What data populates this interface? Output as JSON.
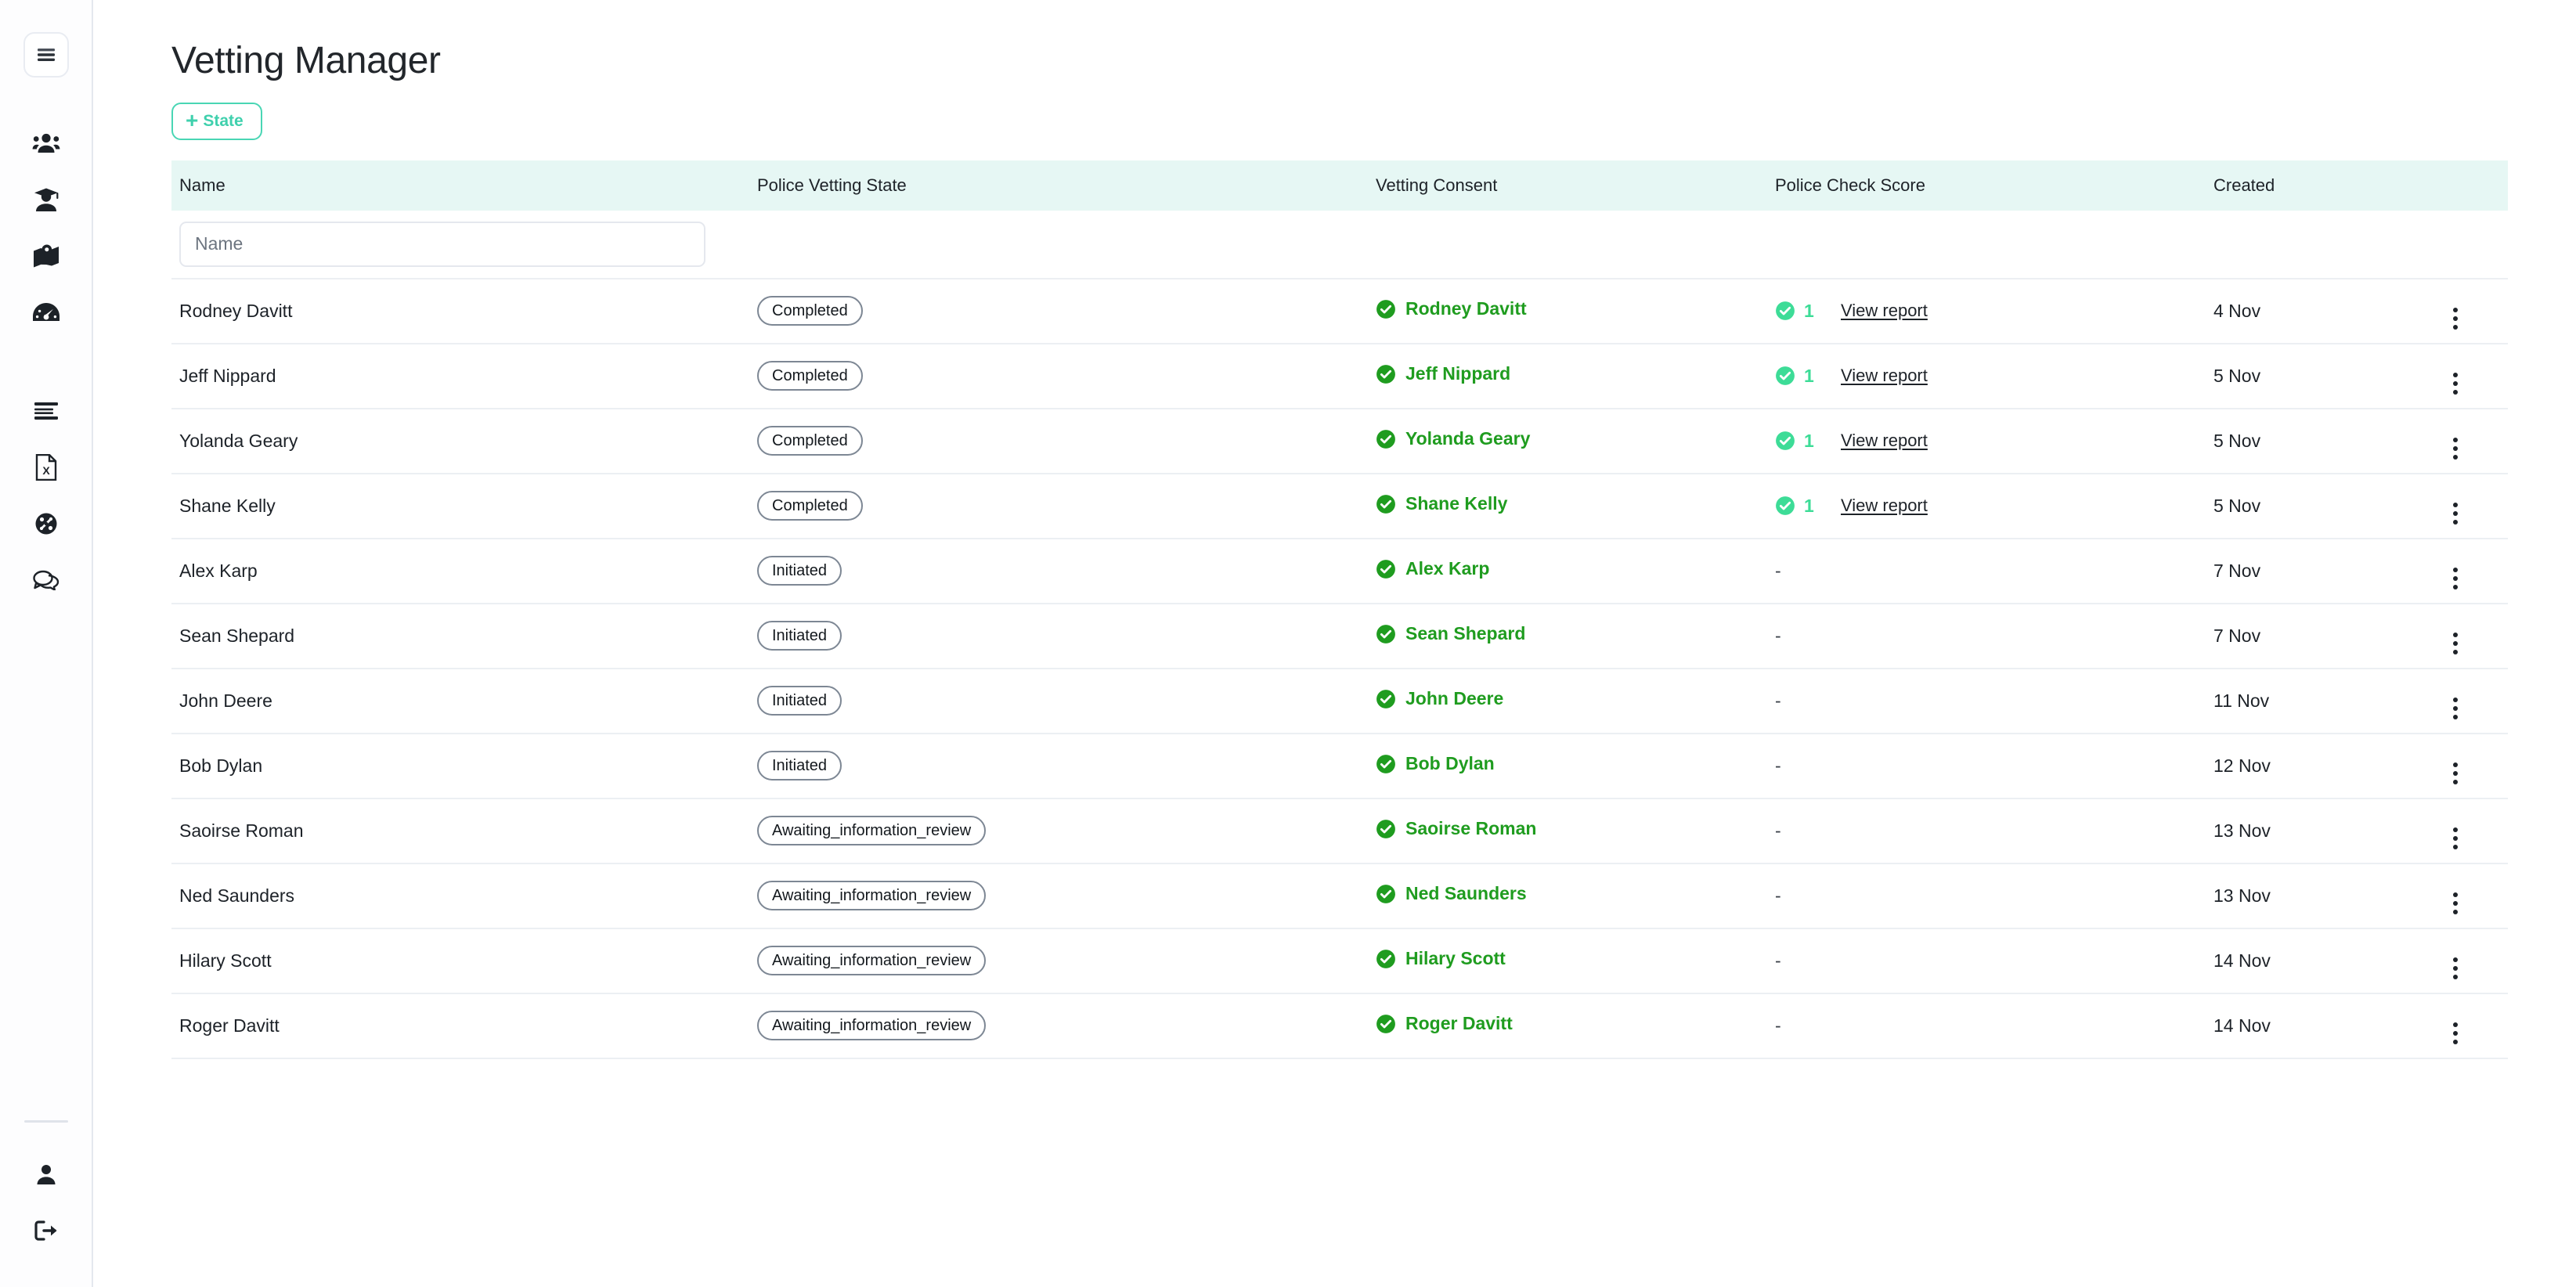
{
  "sidebar": {
    "menu_toggle": "menu-toggle",
    "items": [
      {
        "name": "sidebar-item-people",
        "icon": "people-icon"
      },
      {
        "name": "sidebar-item-students",
        "icon": "graduation-cap-icon"
      },
      {
        "name": "sidebar-item-map",
        "icon": "map-pin-icon"
      },
      {
        "name": "sidebar-item-dashboard",
        "icon": "speedometer-icon"
      }
    ],
    "items_secondary": [
      {
        "name": "sidebar-item-lists",
        "icon": "list-lines-icon"
      },
      {
        "name": "sidebar-item-spreadsheet",
        "icon": "excel-file-icon"
      },
      {
        "name": "sidebar-item-integrations",
        "icon": "burst-icon"
      },
      {
        "name": "sidebar-item-messages",
        "icon": "chat-bubbles-icon"
      }
    ],
    "bottom_items": [
      {
        "name": "sidebar-item-profile",
        "icon": "person-icon"
      },
      {
        "name": "sidebar-item-logout",
        "icon": "logout-icon"
      }
    ]
  },
  "header": {
    "title": "Vetting Manager",
    "add_state_label": "State",
    "add_state_plus": "+"
  },
  "table": {
    "columns": [
      "Name",
      "Police Vetting State",
      "Vetting Consent",
      "Police Check Score",
      "Created",
      ""
    ],
    "filters": {
      "name_placeholder": "Name",
      "name_value": ""
    },
    "report_link_label": "View report",
    "empty_value": "-",
    "rows": [
      {
        "name": "Rodney Davitt",
        "state": "Completed",
        "consent": "Rodney Davitt",
        "score": "1",
        "has_report": true,
        "created": "4 Nov"
      },
      {
        "name": "Jeff Nippard",
        "state": "Completed",
        "consent": "Jeff Nippard",
        "score": "1",
        "has_report": true,
        "created": "5 Nov"
      },
      {
        "name": "Yolanda Geary",
        "state": "Completed",
        "consent": "Yolanda Geary",
        "score": "1",
        "has_report": true,
        "created": "5 Nov"
      },
      {
        "name": "Shane Kelly",
        "state": "Completed",
        "consent": "Shane Kelly",
        "score": "1",
        "has_report": true,
        "created": "5 Nov"
      },
      {
        "name": "Alex Karp",
        "state": "Initiated",
        "consent": "Alex Karp",
        "score": "-",
        "has_report": false,
        "created": "7 Nov"
      },
      {
        "name": "Sean Shepard",
        "state": "Initiated",
        "consent": "Sean Shepard",
        "score": "-",
        "has_report": false,
        "created": "7 Nov"
      },
      {
        "name": "John Deere",
        "state": "Initiated",
        "consent": "John Deere",
        "score": "-",
        "has_report": false,
        "created": "11 Nov"
      },
      {
        "name": "Bob Dylan",
        "state": "Initiated",
        "consent": "Bob Dylan",
        "score": "-",
        "has_report": false,
        "created": "12 Nov"
      },
      {
        "name": "Saoirse Roman",
        "state": "Awaiting_information_review",
        "consent": "Saoirse Roman",
        "score": "-",
        "has_report": false,
        "created": "13 Nov"
      },
      {
        "name": "Ned Saunders",
        "state": "Awaiting_information_review",
        "consent": "Ned Saunders",
        "score": "-",
        "has_report": false,
        "created": "13 Nov"
      },
      {
        "name": "Hilary Scott",
        "state": "Awaiting_information_review",
        "consent": "Hilary Scott",
        "score": "-",
        "has_report": false,
        "created": "14 Nov"
      },
      {
        "name": "Roger Davitt",
        "state": "Awaiting_information_review",
        "consent": "Roger Davitt",
        "score": "-",
        "has_report": false,
        "created": "14 Nov"
      }
    ]
  },
  "colors": {
    "accent_mint": "#3ddc97",
    "accent_teal": "#49d6b4",
    "consent_green": "#1f9c1f",
    "header_bg": "#e6f7f4",
    "text_dark": "#1d2228"
  }
}
